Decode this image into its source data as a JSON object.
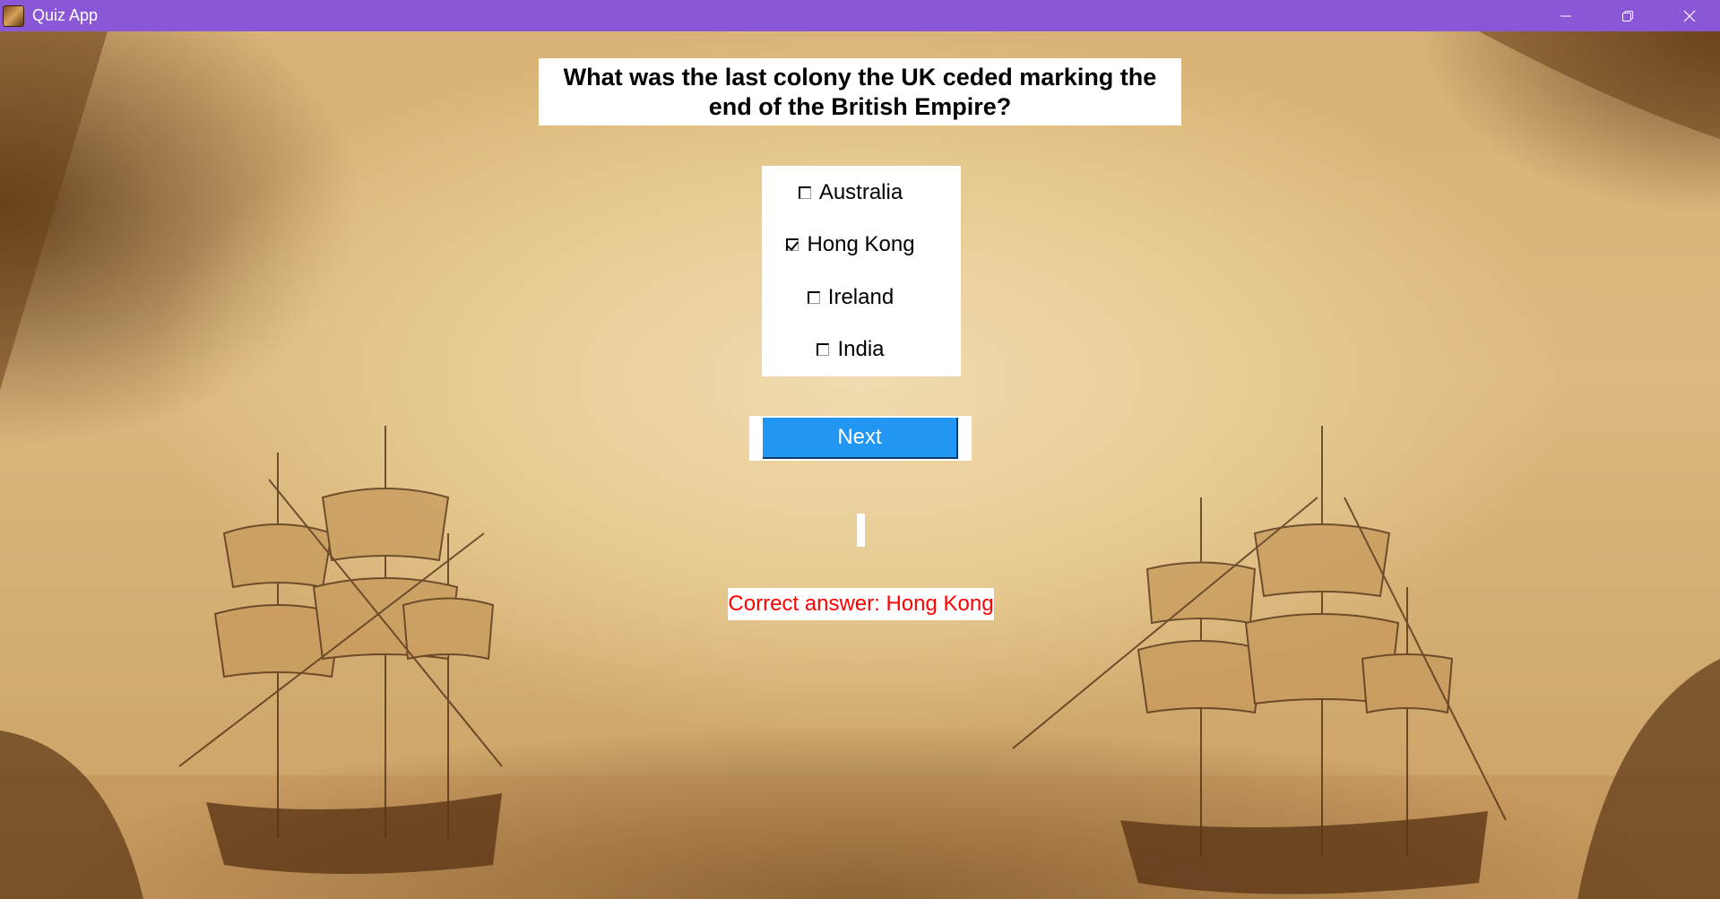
{
  "window": {
    "title": "Quiz App",
    "controls": [
      "minimize",
      "restore",
      "close"
    ],
    "titlebar_color": "#8a57d6"
  },
  "quiz": {
    "question": "What was the last colony the UK ceded marking the end of the British Empire?",
    "options": [
      {
        "label": "Australia",
        "checked": false
      },
      {
        "label": "Hong Kong",
        "checked": true
      },
      {
        "label": "Ireland",
        "checked": false
      },
      {
        "label": "India",
        "checked": false
      }
    ],
    "next_label": "Next",
    "result": "Correct answer: Hong Kong",
    "result_color": "#ff0000",
    "button_color": "#2196f3"
  },
  "icons": {
    "app": "ship-map-icon",
    "minimize": "minimize-icon",
    "restore": "restore-icon",
    "close": "close-icon"
  }
}
